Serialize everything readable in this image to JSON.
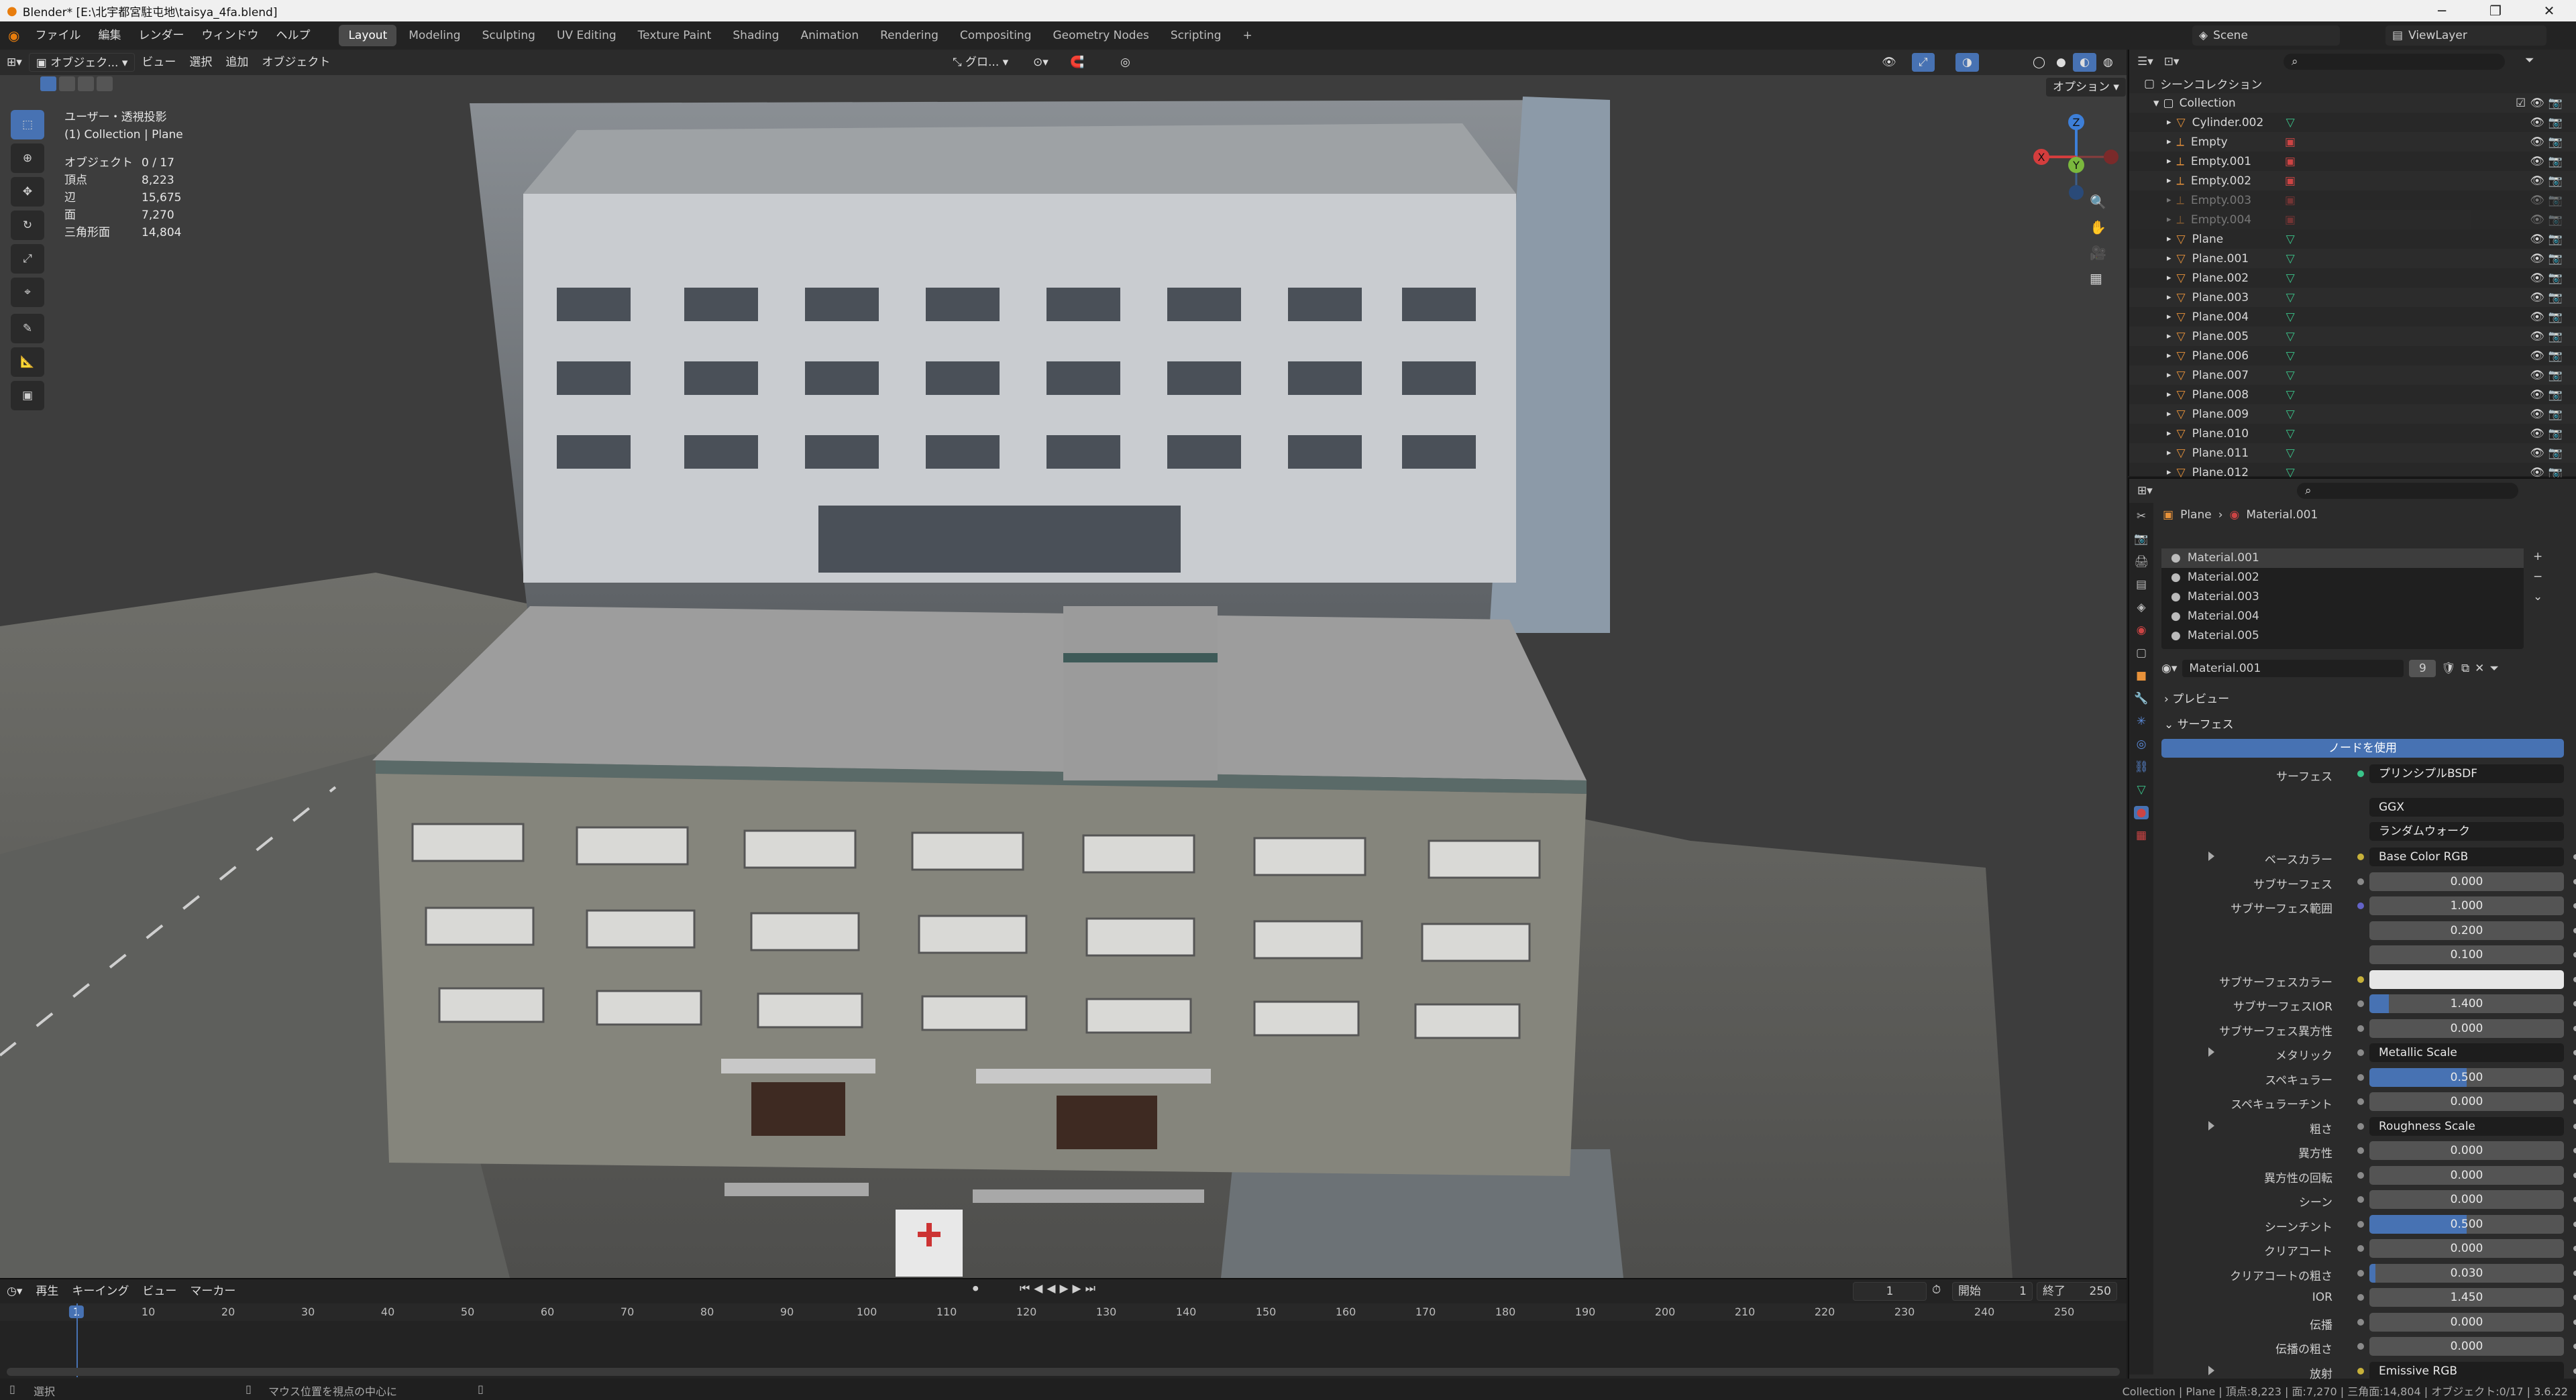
{
  "window": {
    "title": "Blender* [E:\\北宇都宮駐屯地\\taisya_4fa.blend]",
    "minimize": "─",
    "maximize": "❐",
    "close": "✕"
  },
  "menu": [
    "ファイル",
    "編集",
    "レンダー",
    "ウィンドウ",
    "ヘルプ"
  ],
  "workspaces": [
    {
      "label": "Layout",
      "active": true
    },
    {
      "label": "Modeling"
    },
    {
      "label": "Sculpting"
    },
    {
      "label": "UV Editing"
    },
    {
      "label": "Texture Paint"
    },
    {
      "label": "Shading"
    },
    {
      "label": "Animation"
    },
    {
      "label": "Rendering"
    },
    {
      "label": "Compositing"
    },
    {
      "label": "Geometry Nodes"
    },
    {
      "label": "Scripting"
    }
  ],
  "add_workspace": "+",
  "scene": {
    "label": "Scene",
    "view_layer": "ViewLayer"
  },
  "viewport": {
    "mode": "オブジェク...",
    "menus": [
      "ビュー",
      "選択",
      "追加",
      "オブジェクト"
    ],
    "transform": "グロ...",
    "options": "オプション",
    "view_name": "ユーザー・透視投影",
    "collection_line": "(1) Collection | Plane",
    "stats": [
      {
        "label": "オブジェクト",
        "value": "0 / 17"
      },
      {
        "label": "頂点",
        "value": "8,223"
      },
      {
        "label": "辺",
        "value": "15,675"
      },
      {
        "label": "面",
        "value": "7,270"
      },
      {
        "label": "三角形面",
        "value": "14,804"
      }
    ],
    "gizmo": {
      "z": "Z",
      "y": "Y",
      "x": "X"
    }
  },
  "timeline": {
    "menus": [
      "再生",
      "キーイング",
      "ビュー",
      "マーカー"
    ],
    "current_frame": "1",
    "start_label": "開始",
    "start": "1",
    "end_label": "終了",
    "end": "250",
    "ticks": [
      "1",
      "10",
      "20",
      "30",
      "40",
      "50",
      "60",
      "70",
      "80",
      "90",
      "100",
      "110",
      "120",
      "130",
      "140",
      "150",
      "160",
      "170",
      "180",
      "190",
      "200",
      "210",
      "220",
      "230",
      "240",
      "250"
    ]
  },
  "status": {
    "left": "選択",
    "middle": "マウス位置を視点の中心に",
    "right": "Collection | Plane | 頂点:8,223 | 面:7,270 | 三角面:14,804 | オブジェクト:0/17 | 3.6.22"
  },
  "outliner": {
    "root": "シーンコレクション",
    "collection": "Collection",
    "items": [
      {
        "name": "Cylinder.002",
        "type": "mesh"
      },
      {
        "name": "Empty",
        "type": "empty"
      },
      {
        "name": "Empty.001",
        "type": "empty"
      },
      {
        "name": "Empty.002",
        "type": "empty"
      },
      {
        "name": "Empty.003",
        "type": "empty",
        "dim": true
      },
      {
        "name": "Empty.004",
        "type": "empty",
        "dim": true
      },
      {
        "name": "Plane",
        "type": "mesh"
      },
      {
        "name": "Plane.001",
        "type": "mesh"
      },
      {
        "name": "Plane.002",
        "type": "mesh"
      },
      {
        "name": "Plane.003",
        "type": "mesh"
      },
      {
        "name": "Plane.004",
        "type": "mesh"
      },
      {
        "name": "Plane.005",
        "type": "mesh"
      },
      {
        "name": "Plane.006",
        "type": "mesh"
      },
      {
        "name": "Plane.007",
        "type": "mesh"
      },
      {
        "name": "Plane.008",
        "type": "mesh"
      },
      {
        "name": "Plane.009",
        "type": "mesh"
      },
      {
        "name": "Plane.010",
        "type": "mesh"
      },
      {
        "name": "Plane.011",
        "type": "mesh"
      },
      {
        "name": "Plane.012",
        "type": "mesh"
      }
    ]
  },
  "properties": {
    "breadcrumb_object": "Plane",
    "breadcrumb_material": "Material.001",
    "slots": [
      "Material.001",
      "Material.002",
      "Material.003",
      "Material.004",
      "Material.005"
    ],
    "material_name": "Material.001",
    "user_count": "9",
    "preview_label": "プレビュー",
    "surface_label": "サーフェス",
    "use_nodes": "ノードを使用",
    "surface_field_label": "サーフェス",
    "surface_shader": "プリンシプルBSDF",
    "distribution": "GGX",
    "subsurface_method": "ランダムウォーク",
    "rows": [
      {
        "label": "ベースカラー",
        "value": "Base Color RGB",
        "kind": "link",
        "dot": "#c7b13a",
        "expand": true
      },
      {
        "label": "サブサーフェス",
        "value": "0.000",
        "kind": "num",
        "dot": "#8a8a8a",
        "fill": 0
      },
      {
        "label": "サブサーフェス範囲",
        "value": "1.000",
        "kind": "num",
        "dot": "#6363c7",
        "fill": 0
      },
      {
        "label": "",
        "value": "0.200",
        "kind": "num",
        "fill": 0
      },
      {
        "label": "",
        "value": "0.100",
        "kind": "num",
        "fill": 0
      },
      {
        "label": "サブサーフェスカラー",
        "value": "",
        "kind": "color",
        "dot": "#c7b13a",
        "color": "#e6e6e6"
      },
      {
        "label": "サブサーフェスIOR",
        "value": "1.400",
        "kind": "num",
        "dot": "#8a8a8a",
        "fill": 0.1
      },
      {
        "label": "サブサーフェス異方性",
        "value": "0.000",
        "kind": "num",
        "dot": "#8a8a8a",
        "fill": 0
      },
      {
        "label": "メタリック",
        "value": "Metallic Scale",
        "kind": "link",
        "dot": "#8a8a8a",
        "expand": true
      },
      {
        "label": "スペキュラー",
        "value": "0.500",
        "kind": "num",
        "dot": "#8a8a8a",
        "fill": 0.5
      },
      {
        "label": "スペキュラーチント",
        "value": "0.000",
        "kind": "num",
        "dot": "#8a8a8a",
        "fill": 0
      },
      {
        "label": "粗さ",
        "value": "Roughness Scale",
        "kind": "link",
        "dot": "#8a8a8a",
        "expand": true
      },
      {
        "label": "異方性",
        "value": "0.000",
        "kind": "num",
        "dot": "#8a8a8a",
        "fill": 0
      },
      {
        "label": "異方性の回転",
        "value": "0.000",
        "kind": "num",
        "dot": "#8a8a8a",
        "fill": 0
      },
      {
        "label": "シーン",
        "value": "0.000",
        "kind": "num",
        "dot": "#8a8a8a",
        "fill": 0
      },
      {
        "label": "シーンチント",
        "value": "0.500",
        "kind": "num",
        "dot": "#8a8a8a",
        "fill": 0.5
      },
      {
        "label": "クリアコート",
        "value": "0.000",
        "kind": "num",
        "dot": "#8a8a8a",
        "fill": 0
      },
      {
        "label": "クリアコートの粗さ",
        "value": "0.030",
        "kind": "num",
        "dot": "#8a8a8a",
        "fill": 0.03
      },
      {
        "label": "IOR",
        "value": "1.450",
        "kind": "num",
        "dot": "#8a8a8a",
        "fill": 0
      },
      {
        "label": "伝播",
        "value": "0.000",
        "kind": "num",
        "dot": "#8a8a8a",
        "fill": 0
      },
      {
        "label": "伝播の粗さ",
        "value": "0.000",
        "kind": "num",
        "dot": "#8a8a8a",
        "fill": 0
      },
      {
        "label": "放射",
        "value": "Emissive RGB",
        "kind": "link",
        "dot": "#c7b13a",
        "expand": true
      }
    ]
  }
}
